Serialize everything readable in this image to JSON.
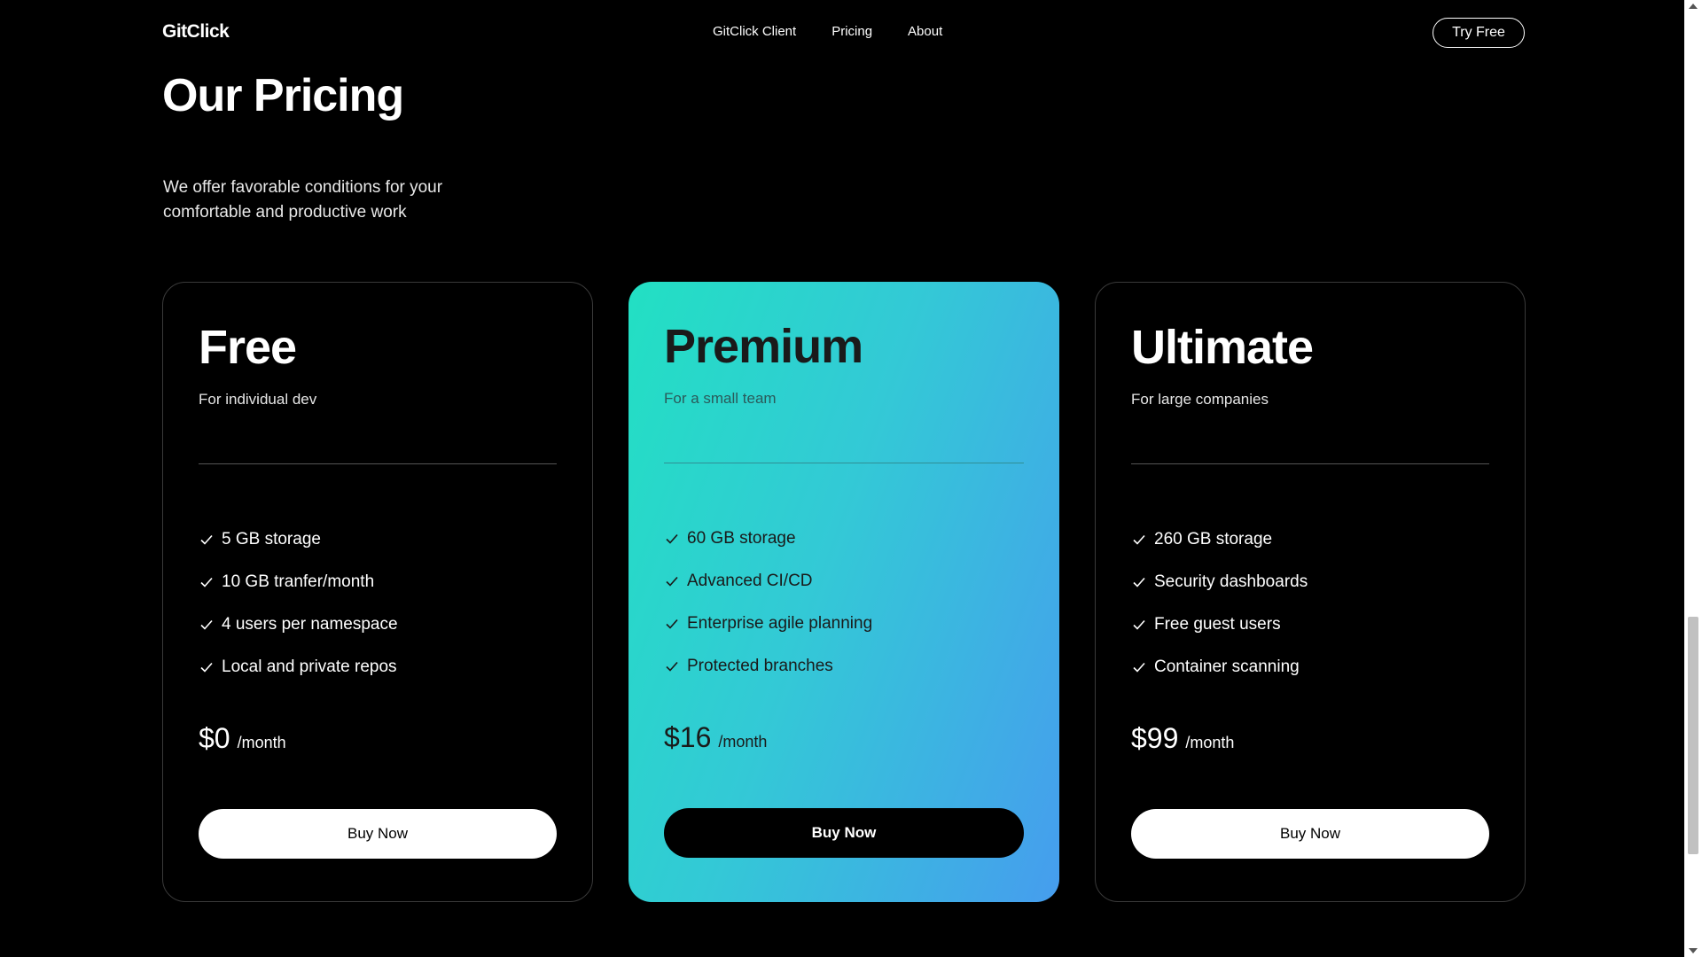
{
  "header": {
    "logo": "GitClick",
    "nav": [
      "GitClick Client",
      "Pricing",
      "About"
    ],
    "cta_label": "Try Free"
  },
  "hero": {
    "title": "Our Pricing",
    "subtitle": "We offer favorable conditions for your comfortable and productive work"
  },
  "plans": [
    {
      "name": "Free",
      "description": "For individual dev",
      "features": [
        "5 GB storage",
        "10 GB tranfer/month",
        "4 users per namespace",
        "Local and private repos"
      ],
      "price": "$0",
      "price_unit": "/month",
      "button_label": "Buy Now"
    },
    {
      "name": "Premium",
      "description": "For a small team",
      "features": [
        "60 GB storage",
        "Advanced CI/CD",
        "Enterprise agile planning",
        "Protected branches"
      ],
      "price": "$16",
      "price_unit": "/month",
      "button_label": "Buy Now"
    },
    {
      "name": "Ultimate",
      "description": "For large companies",
      "features": [
        "260 GB storage",
        "Security dashboards",
        "Free guest users",
        "Container scanning"
      ],
      "price": "$99",
      "price_unit": "/month",
      "button_label": "Buy Now"
    }
  ],
  "colors": {
    "background": "#000000",
    "featured_gradient_start": "#22e0c3",
    "featured_gradient_end": "#469dee"
  }
}
